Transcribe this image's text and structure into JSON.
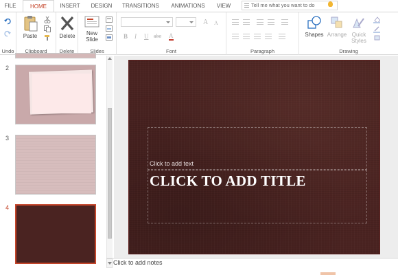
{
  "tabs": [
    "FILE",
    "HOME",
    "INSERT",
    "DESIGN",
    "TRANSITIONS",
    "ANIMATIONS",
    "VIEW"
  ],
  "active_tab": "HOME",
  "search": {
    "placeholder": "Tell me what you want to do"
  },
  "ribbon": {
    "groups": {
      "undo": "Undo",
      "clipboard": "Clipboard",
      "delete": "Delete",
      "slides": "Slides",
      "font": "Font",
      "paragraph": "Paragraph",
      "drawing": "Drawing"
    },
    "buttons": {
      "paste": "Paste",
      "delete": "Delete",
      "new_slide_1": "New",
      "new_slide_2": "Slide",
      "shapes": "Shapes",
      "arrange": "Arrange",
      "quick_styles_1": "Quick",
      "quick_styles_2": "Styles"
    },
    "font_glyphs": {
      "bold": "B",
      "italic": "I",
      "underline": "U",
      "strike": "abc",
      "font_color": "A",
      "grow": "A",
      "shrink": "A"
    }
  },
  "slide_numbers": [
    "2",
    "3",
    "4"
  ],
  "slide": {
    "subtitle": "Click to add text",
    "title": "CLICK TO ADD TITLE"
  },
  "notes": "Click to add notes",
  "colors": {
    "accent": "#c4452a",
    "slide_background": "#4a2321",
    "thumb_pink": "#d9bfbf"
  }
}
